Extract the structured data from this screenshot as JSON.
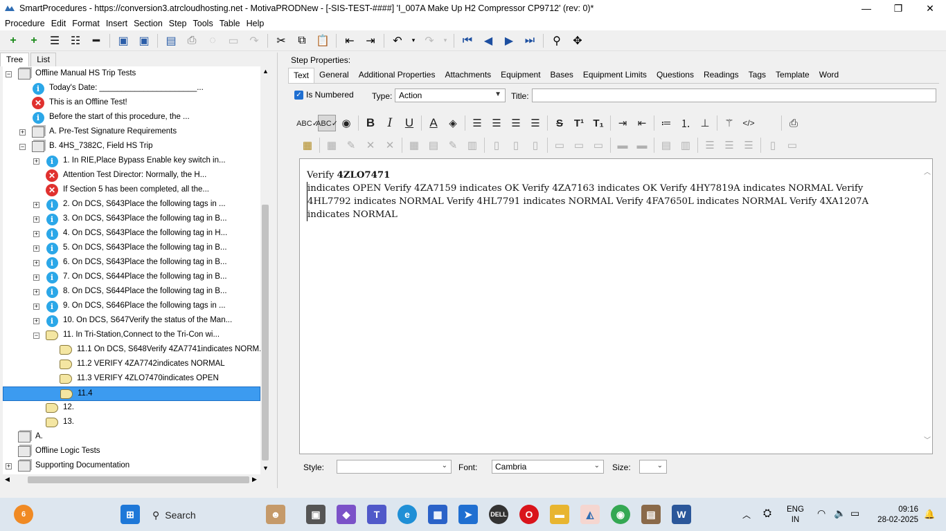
{
  "window": {
    "title": "SmartProcedures - https://conversion3.atrcloudhosting.net - MotivaPRODNew - [-SIS-TEST-####] 'I_007A Make Up H2 Compressor CP9712' (rev: 0)*",
    "minimize": "—",
    "restore": "❐",
    "close": "✕"
  },
  "menu": [
    "Procedure",
    "Edit",
    "Format",
    "Insert",
    "Section",
    "Step",
    "Tools",
    "Table",
    "Help"
  ],
  "left_tabs": [
    "Tree",
    "List"
  ],
  "tree": [
    {
      "label": "Offline Manual HS Trip Tests",
      "icon": "book",
      "expander": "−",
      "level": 0
    },
    {
      "label": "Today's Date: ______________________...",
      "icon": "info",
      "expander": "",
      "level": 1
    },
    {
      "label": "This is an Offline Test!",
      "icon": "warning",
      "expander": "",
      "level": 1
    },
    {
      "label": "Before the start of this procedure, the ...",
      "icon": "info",
      "expander": "",
      "level": 1
    },
    {
      "label": "A. Pre-Test Signature Requirements",
      "icon": "book",
      "expander": "+",
      "level": 1
    },
    {
      "label": "B. 4HS_7382C, Field HS Trip",
      "icon": "book",
      "expander": "−",
      "level": 1
    },
    {
      "label": "1. In RIE,Place Bypass Enable key switch in...",
      "icon": "info",
      "expander": "+",
      "level": 2
    },
    {
      "label": "Attention Test Director: Normally, the H...",
      "icon": "warning",
      "expander": "",
      "level": 2
    },
    {
      "label": "If Section 5 has been completed, all the...",
      "icon": "warning",
      "expander": "",
      "level": 2
    },
    {
      "label": "2. On DCS, S643Place the following tags in ...",
      "icon": "info",
      "expander": "+",
      "level": 2
    },
    {
      "label": "3. On DCS, S643Place the following tag in B...",
      "icon": "info",
      "expander": "+",
      "level": 2
    },
    {
      "label": "4. On DCS, S643Place the following tag in H...",
      "icon": "info",
      "expander": "+",
      "level": 2
    },
    {
      "label": "5. On DCS, S643Place the following tag in B...",
      "icon": "info",
      "expander": "+",
      "level": 2
    },
    {
      "label": "6. On DCS, S643Place the following tag in B...",
      "icon": "info",
      "expander": "+",
      "level": 2
    },
    {
      "label": "7. On DCS, S644Place the following tag in B...",
      "icon": "info",
      "expander": "+",
      "level": 2
    },
    {
      "label": "8. On DCS, S644Place the following tag in B...",
      "icon": "info",
      "expander": "+",
      "level": 2
    },
    {
      "label": "9. On DCS, S646Place the following tags in ...",
      "icon": "info",
      "expander": "+",
      "level": 2
    },
    {
      "label": "10. On DCS, S647Verify the status of the Man...",
      "icon": "info",
      "expander": "+",
      "level": 2
    },
    {
      "label": "11. In Tri-Station,Connect to the Tri-Con wi...",
      "icon": "hand",
      "expander": "−",
      "level": 2
    },
    {
      "label": "11.1 On DCS, S648Verify 4ZA7741indicates NORM...",
      "icon": "hand",
      "expander": "",
      "level": 3
    },
    {
      "label": "11.2 VERIFY 4ZA7742indicates NORMAL",
      "icon": "hand",
      "expander": "",
      "level": 3
    },
    {
      "label": "11.3 VERIFY 4ZLO7470indicates OPEN",
      "icon": "hand",
      "expander": "",
      "level": 3
    },
    {
      "label": "11.4",
      "icon": "hand",
      "expander": "",
      "level": 3,
      "selected": true
    },
    {
      "label": "12.",
      "icon": "hand",
      "expander": "",
      "level": 2
    },
    {
      "label": "13.",
      "icon": "hand",
      "expander": "",
      "level": 2
    },
    {
      "label": "A.",
      "icon": "book",
      "expander": "",
      "level": 0
    },
    {
      "label": "Offline Logic Tests",
      "icon": "book",
      "expander": "",
      "level": 0
    },
    {
      "label": "Supporting Documentation",
      "icon": "book",
      "expander": "+",
      "level": 0
    }
  ],
  "step_properties": {
    "heading": "Step Properties:",
    "tabs": [
      "Text",
      "General",
      "Additional Properties",
      "Attachments",
      "Equipment",
      "Bases",
      "Equipment Limits",
      "Questions",
      "Readings",
      "Tags",
      "Template",
      "Word"
    ],
    "is_numbered_label": "Is Numbered",
    "type_label": "Type:",
    "type_value": "Action",
    "title_label": "Title:",
    "title_value": ""
  },
  "editor": {
    "line1_prefix": "Verify ",
    "line1_bold": "4ZLO7471",
    "body": "indicates OPEN Verify 4ZA7159  indicates OK Verify 4ZA7163  indicates OK Verify 4HY7819A  indicates NORMAL Verify 4HL7792  indicates NORMAL Verify 4HL7791  indicates NORMAL Verify 4FA7650L  indicates NORMAL Verify 4XA1207A  indicates NORMAL"
  },
  "bottom_bar": {
    "style_label": "Style:",
    "style_value": "",
    "font_label": "Font:",
    "font_value": "Cambria",
    "size_label": "Size:",
    "size_value": ""
  },
  "taskbar": {
    "search_placeholder": "Search",
    "notification_count": "6",
    "lang_line1": "ENG",
    "lang_line2": "IN",
    "time": "09:16",
    "date": "28-02-2025"
  },
  "colors": {
    "selection": "#3c9bf0",
    "info_icon": "#2ba7e8",
    "warning_icon": "#e0312f",
    "taskbar": "#dde6ef"
  }
}
